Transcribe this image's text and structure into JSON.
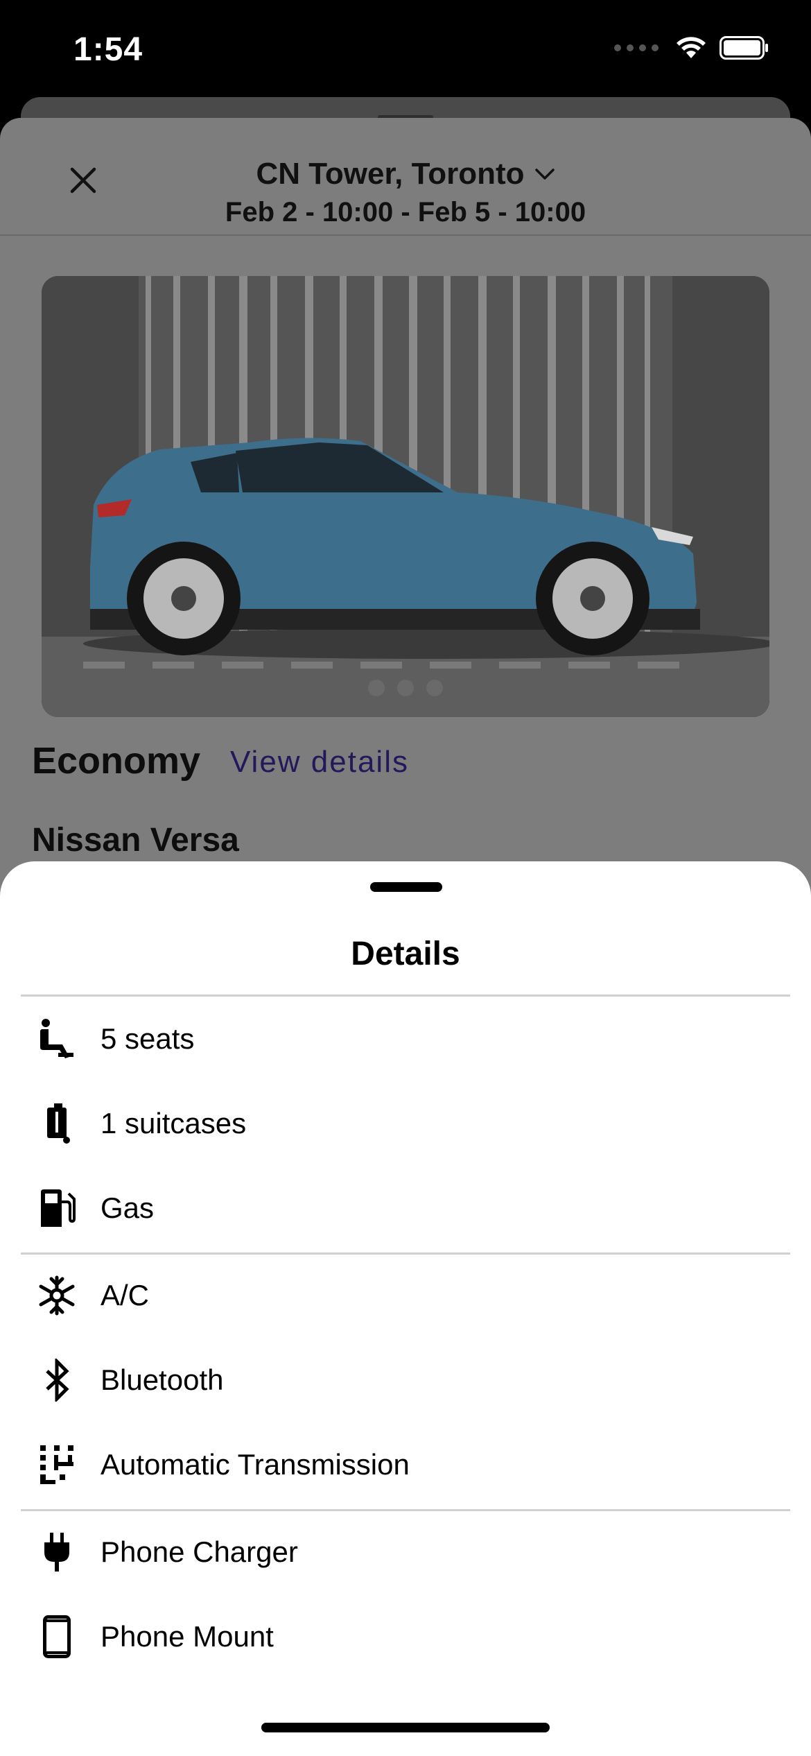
{
  "status_bar": {
    "time": "1:54"
  },
  "header": {
    "location": "CN Tower, Toronto",
    "dates": "Feb 2 - 10:00 - Feb 5 - 10:00"
  },
  "carousel": {
    "dot_count": 3
  },
  "vehicle": {
    "category": "Economy",
    "view_details_label": "View details",
    "model": "Nissan Versa",
    "image_color": "#3d6e8c"
  },
  "details": {
    "title": "Details",
    "groups": [
      [
        {
          "icon": "seat-icon",
          "label": "5 seats"
        },
        {
          "icon": "suitcase-icon",
          "label": "1 suitcases"
        },
        {
          "icon": "fuel-pump-icon",
          "label": "Gas"
        }
      ],
      [
        {
          "icon": "snowflake-icon",
          "label": "A/C"
        },
        {
          "icon": "bluetooth-icon",
          "label": "Bluetooth"
        },
        {
          "icon": "gear-shift-icon",
          "label": "Automatic Transmission"
        }
      ],
      [
        {
          "icon": "plug-icon",
          "label": "Phone Charger"
        },
        {
          "icon": "phone-icon",
          "label": "Phone Mount"
        }
      ]
    ]
  }
}
